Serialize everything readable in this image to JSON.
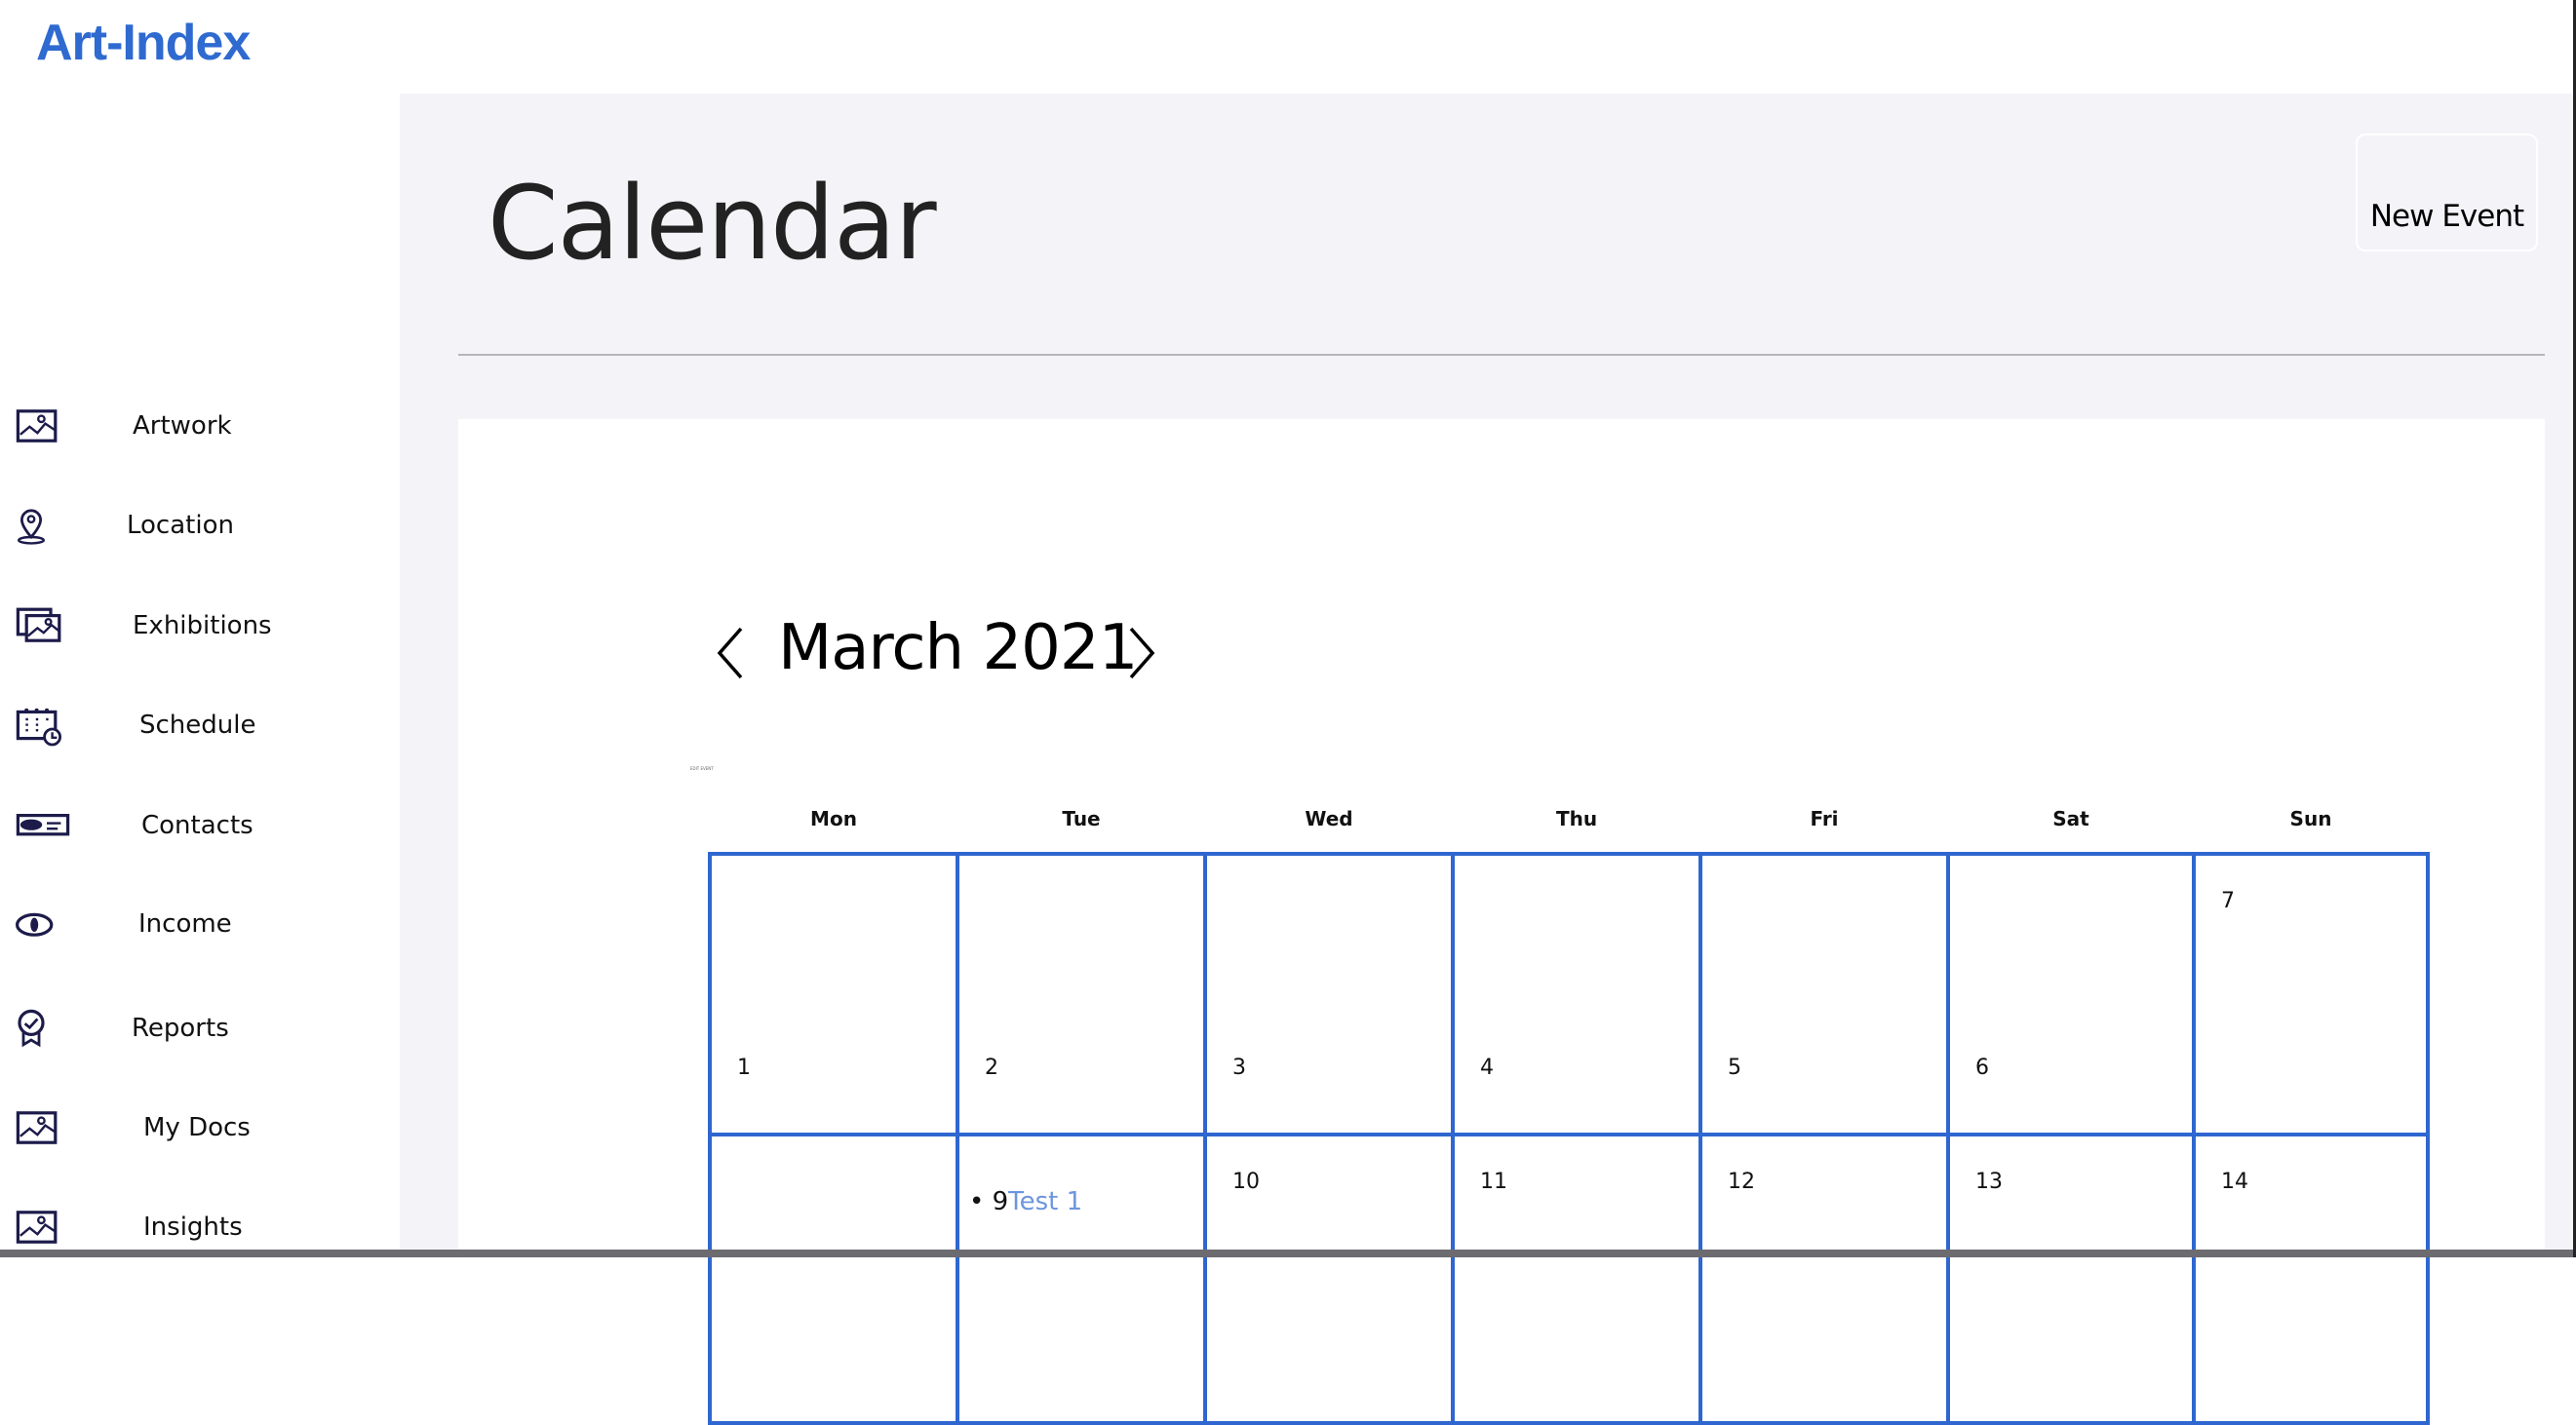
{
  "app": {
    "logo": "Art-Index",
    "brand_color": "#2e6ad0"
  },
  "sidebar": {
    "items": [
      {
        "label": "Artwork",
        "icon": "image-icon"
      },
      {
        "label": "Location",
        "icon": "map-pin-icon"
      },
      {
        "label": "Exhibitions",
        "icon": "images-icon"
      },
      {
        "label": "Schedule",
        "icon": "calendar-clock-icon"
      },
      {
        "label": "Contacts",
        "icon": "id-card-icon"
      },
      {
        "label": "Income",
        "icon": "dollar-coin-icon"
      },
      {
        "label": "Reports",
        "icon": "award-check-icon"
      },
      {
        "label": "My Docs",
        "icon": "image-icon"
      },
      {
        "label": "Insights",
        "icon": "image-icon"
      }
    ]
  },
  "header": {
    "title": "Calendar",
    "new_event_label": "New Event"
  },
  "calendar": {
    "month_label": "March 2021",
    "edit_event_label": "EDIT EVENT",
    "weekdays": [
      "Mon",
      "Tue",
      "Wed",
      "Thu",
      "Fri",
      "Sat",
      "Sun"
    ],
    "grid_color": "#2f66d0",
    "weeks": [
      [
        "1",
        "2",
        "3",
        "4",
        "5",
        "6",
        "7"
      ],
      [
        "",
        "9",
        "10",
        "11",
        "12",
        "13",
        "14"
      ]
    ],
    "events": [
      {
        "day": "9",
        "title": "Test 1"
      }
    ]
  }
}
